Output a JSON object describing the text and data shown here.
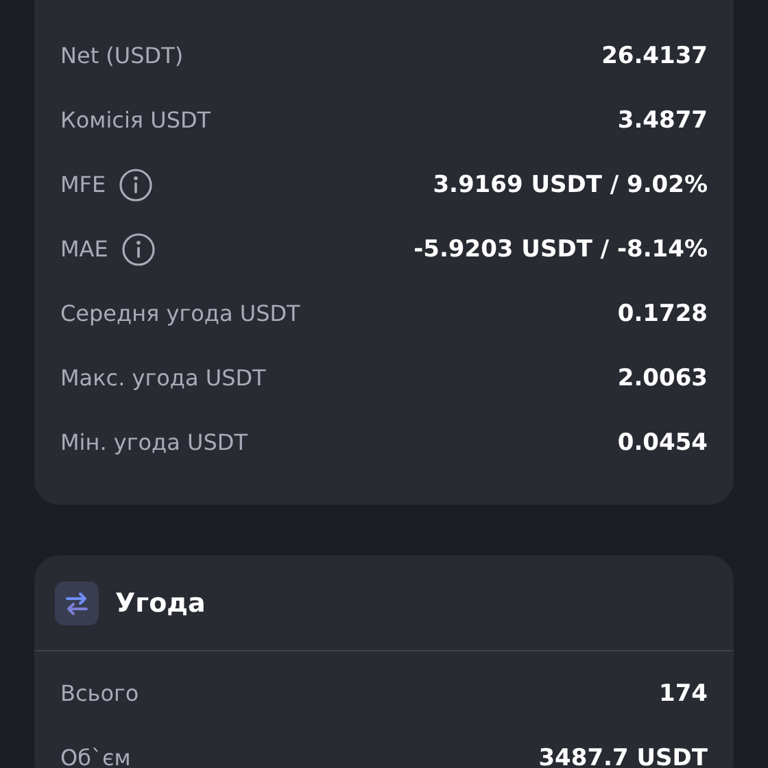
{
  "stats_card": {
    "rows": [
      {
        "label": "Net (USDT)",
        "value": "26.4137",
        "info": false
      },
      {
        "label": "Комісія USDT",
        "value": "3.4877",
        "info": false
      },
      {
        "label": "MFE",
        "value": "3.9169 USDT / 9.02%",
        "info": true
      },
      {
        "label": "MAE",
        "value": "-5.9203 USDT / -8.14%",
        "info": true
      },
      {
        "label": "Середня угода USDT",
        "value": "0.1728",
        "info": false
      },
      {
        "label": "Макс. угода USDT",
        "value": "2.0063",
        "info": false
      },
      {
        "label": "Мін. угода USDT",
        "value": "0.0454",
        "info": false
      }
    ]
  },
  "trade_card": {
    "title": "Угода",
    "rows": [
      {
        "label": "Всього",
        "value": "174",
        "info": false
      },
      {
        "label": "Об`єм",
        "value": "3487.7 USDT",
        "info": false
      }
    ]
  }
}
